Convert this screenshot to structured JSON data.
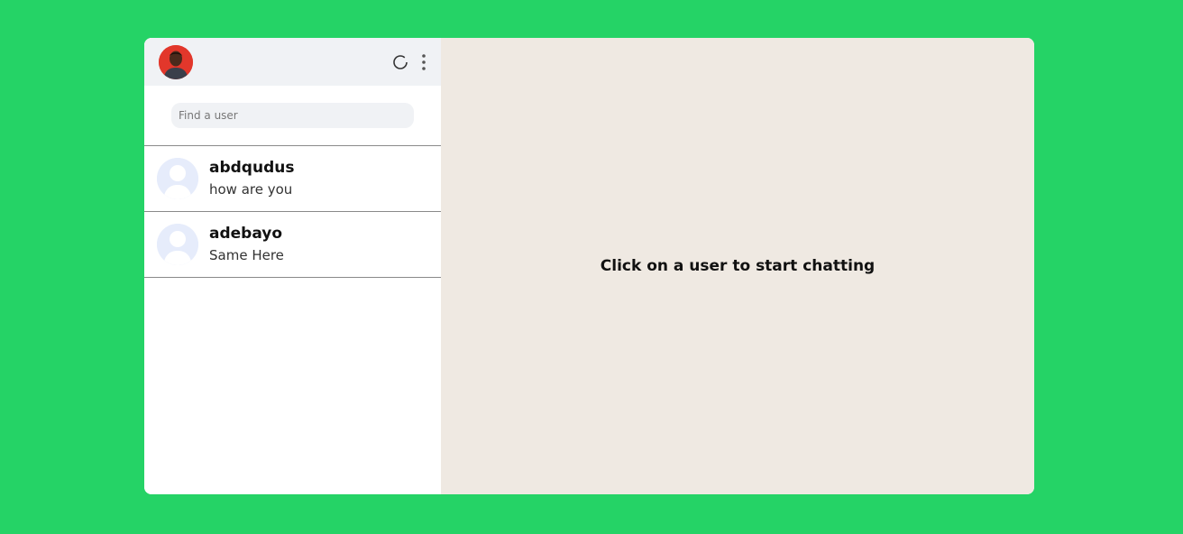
{
  "sidebar": {
    "header": {
      "avatar_icon": "user-profile-photo",
      "status_icon": "circle-refresh-icon",
      "menu_icon": "vertical-dots-icon"
    },
    "search": {
      "placeholder": "Find a user",
      "value": ""
    },
    "conversations": [
      {
        "name": "abdqudus",
        "last_message": "how are you"
      },
      {
        "name": "adebayo",
        "last_message": "Same Here"
      }
    ]
  },
  "main": {
    "empty_message": "Click on a user to start chatting"
  },
  "colors": {
    "background": "#25d366",
    "header": "#f0f2f5",
    "chat_area": "#efe9e2",
    "avatar_placeholder": "#e6ecfb"
  }
}
